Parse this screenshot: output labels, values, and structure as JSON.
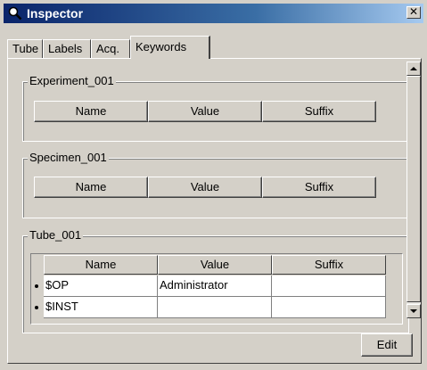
{
  "window": {
    "title": "Inspector"
  },
  "tabs": [
    {
      "label": "Tube"
    },
    {
      "label": "Labels"
    },
    {
      "label": "Acq."
    },
    {
      "label": "Keywords"
    }
  ],
  "groups": [
    {
      "title": "Experiment_001",
      "buttons": [
        "Name",
        "Value",
        "Suffix"
      ]
    },
    {
      "title": "Specimen_001",
      "buttons": [
        "Name",
        "Value",
        "Suffix"
      ]
    },
    {
      "title": "Tube_001",
      "columns": [
        "Name",
        "Value",
        "Suffix"
      ],
      "rows": [
        {
          "name": "$OP",
          "value": "Administrator",
          "suffix": ""
        },
        {
          "name": "$INST",
          "value": "",
          "suffix": ""
        }
      ]
    }
  ],
  "footer": {
    "edit_label": "Edit"
  },
  "icons": {
    "title": "magnifier-icon",
    "close": "close-icon"
  }
}
